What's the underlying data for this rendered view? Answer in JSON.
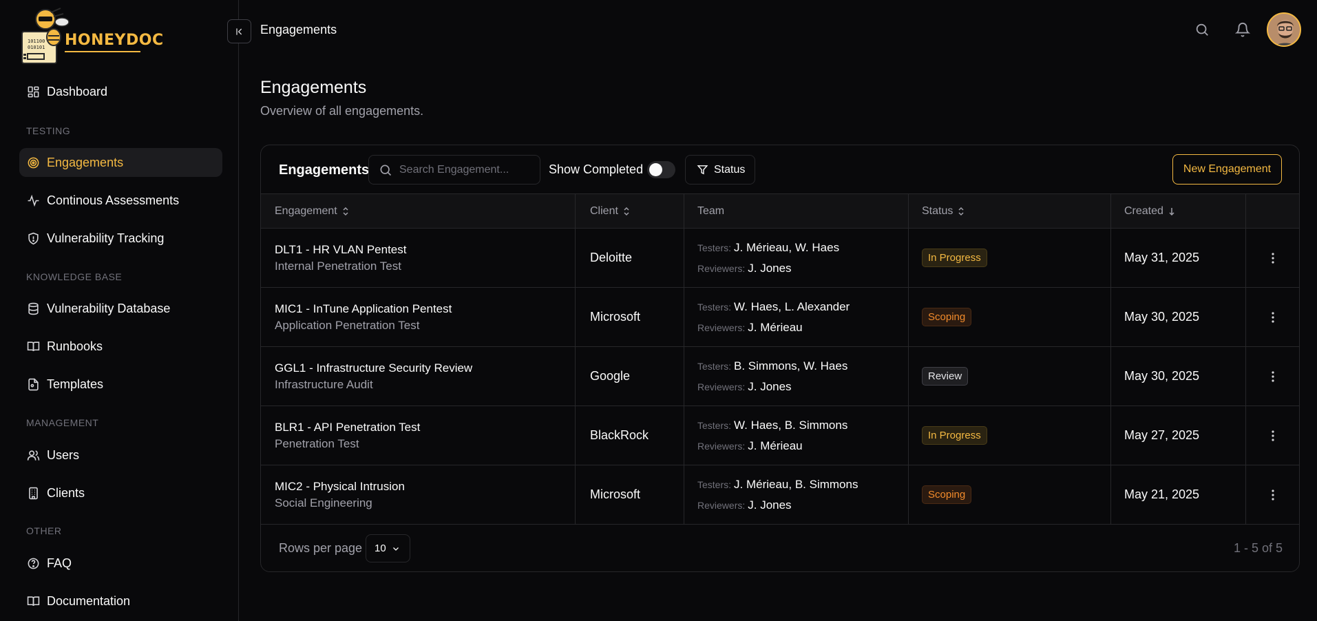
{
  "brand": {
    "name": "HONEYDOC",
    "logo_lines": [
      "101100",
      "010101"
    ]
  },
  "sidebar": {
    "top_items": [
      {
        "label": "Dashboard",
        "icon": "dashboard-icon"
      }
    ],
    "sections": [
      {
        "title": "TESTING",
        "items": [
          {
            "label": "Engagements",
            "icon": "target-icon",
            "active": true
          },
          {
            "label": "Continous Assessments",
            "icon": "activity-icon"
          },
          {
            "label": "Vulnerability Tracking",
            "icon": "shield-icon"
          }
        ]
      },
      {
        "title": "KNOWLEDGE BASE",
        "items": [
          {
            "label": "Vulnerability Database",
            "icon": "database-icon"
          },
          {
            "label": "Runbooks",
            "icon": "book-icon"
          },
          {
            "label": "Templates",
            "icon": "file-icon"
          }
        ]
      },
      {
        "title": "MANAGEMENT",
        "items": [
          {
            "label": "Users",
            "icon": "users-icon"
          },
          {
            "label": "Clients",
            "icon": "building-icon"
          }
        ]
      },
      {
        "title": "OTHER",
        "items": [
          {
            "label": "FAQ",
            "icon": "help-icon"
          },
          {
            "label": "Documentation",
            "icon": "book-icon"
          }
        ]
      }
    ]
  },
  "header": {
    "breadcrumb": "Engagements"
  },
  "page": {
    "title": "Engagements",
    "subtitle": "Overview of all engagements."
  },
  "toolbar": {
    "title": "Engagements",
    "search_placeholder": "Search Engagement...",
    "show_completed_label": "Show Completed",
    "show_completed": false,
    "status_filter_label": "Status",
    "new_button_label": "New Engagement"
  },
  "table": {
    "columns": [
      "Engagement",
      "Client",
      "Team",
      "Status",
      "Created"
    ],
    "testers_label": "Testers:",
    "reviewers_label": "Reviewers:",
    "rows": [
      {
        "name": "DLT1 - HR VLAN Pentest",
        "type": "Internal Penetration Test",
        "client": "Deloitte",
        "testers": "J. Mérieau, W. Haes",
        "reviewers": "J. Jones",
        "status": "In Progress",
        "created": "May 31, 2025"
      },
      {
        "name": "MIC1 - InTune Application Pentest",
        "type": "Application Penetration Test",
        "client": "Microsoft",
        "testers": "W. Haes, L. Alexander",
        "reviewers": "J. Mérieau",
        "status": "Scoping",
        "created": "May 30, 2025"
      },
      {
        "name": "GGL1 - Infrastructure Security Review",
        "type": "Infrastructure Audit",
        "client": "Google",
        "testers": "B. Simmons, W. Haes",
        "reviewers": "J. Jones",
        "status": "Review",
        "created": "May 30, 2025"
      },
      {
        "name": "BLR1 - API Penetration Test",
        "type": "Penetration Test",
        "client": "BlackRock",
        "testers": "W. Haes, B. Simmons",
        "reviewers": "J. Mérieau",
        "status": "In Progress",
        "created": "May 27, 2025"
      },
      {
        "name": "MIC2 - Physical Intrusion",
        "type": "Social Engineering",
        "client": "Microsoft",
        "testers": "J. Mérieau, B. Simmons",
        "reviewers": "J. Jones",
        "status": "Scoping",
        "created": "May 21, 2025"
      }
    ]
  },
  "footer": {
    "rows_per_page_label": "Rows per page",
    "rows_per_page": "10",
    "pagination": "1 - 5 of 5"
  },
  "colors": {
    "accent": "#f4b942",
    "scoping": "#f28b2b",
    "background": "#09090b"
  }
}
